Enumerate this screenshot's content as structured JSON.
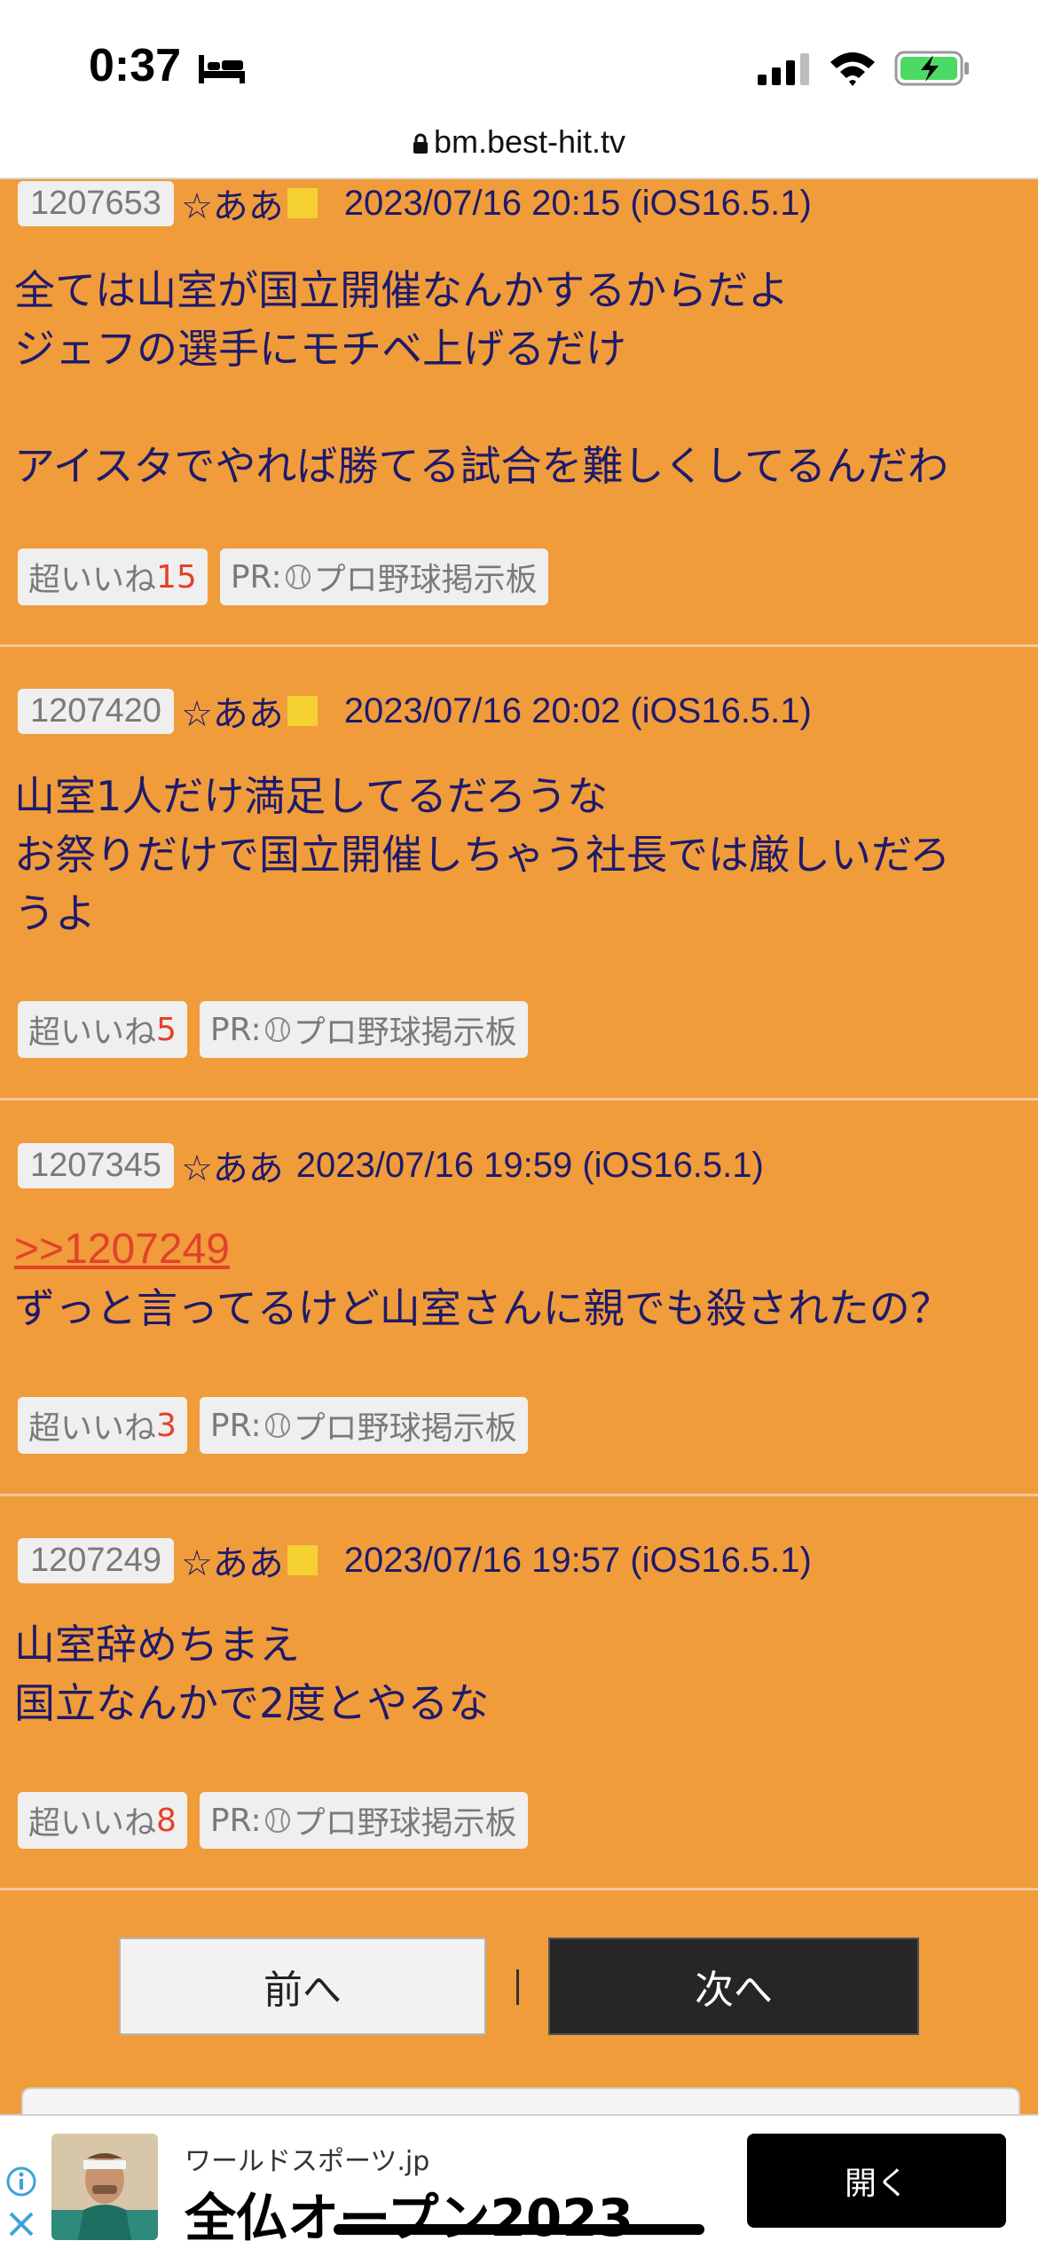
{
  "status_bar": {
    "time": "0:37",
    "url": "bm.best-hit.tv"
  },
  "posts": [
    {
      "id": "1207653",
      "name": "☆ああ",
      "date": "2023/07/16 20:15 (iOS16.5.1)",
      "has_square": true,
      "lines": [
        "全ては山室が国立開催なんかするからだよ",
        "ジェフの選手にモチベ上げるだけ",
        "",
        "アイスタでやれば勝てる試合を難しくしてるんだわ"
      ],
      "like_label": "超いいね",
      "like_count": "15",
      "pr_prefix": "PR:",
      "pr_label": "プロ野球掲示板"
    },
    {
      "id": "1207420",
      "name": "☆ああ",
      "date": "2023/07/16 20:02 (iOS16.5.1)",
      "has_square": true,
      "lines": [
        "山室1人だけ満足してるだろうな",
        "お祭りだけで国立開催しちゃう社長では厳しいだろ",
        "うよ"
      ],
      "like_label": "超いいね",
      "like_count": "5",
      "pr_prefix": "PR:",
      "pr_label": "プロ野球掲示板"
    },
    {
      "id": "1207345",
      "name": "☆ああ",
      "date": "2023/07/16 19:59 (iOS16.5.1)",
      "has_square": false,
      "reply_link": ">>1207249",
      "lines": [
        "ずっと言ってるけど山室さんに親でも殺されたの？"
      ],
      "like_label": "超いいね",
      "like_count": "3",
      "pr_prefix": "PR:",
      "pr_label": "プロ野球掲示板"
    },
    {
      "id": "1207249",
      "name": "☆ああ",
      "date": "2023/07/16 19:57 (iOS16.5.1)",
      "has_square": true,
      "lines": [
        "山室辞めちまえ",
        "国立なんかで2度とやるな"
      ],
      "like_label": "超いいね",
      "like_count": "8",
      "pr_prefix": "PR:",
      "pr_label": "プロ野球掲示板"
    }
  ],
  "pager": {
    "prev_label": "前へ",
    "next_label": "次へ"
  },
  "ad": {
    "source": "ワールドスポーツ.jp",
    "headline": "全仏オープン2023",
    "open_label": "開く"
  },
  "colors": {
    "background": "#f09c3a",
    "text": "#1f1a6b",
    "accent": "#e3412a"
  }
}
